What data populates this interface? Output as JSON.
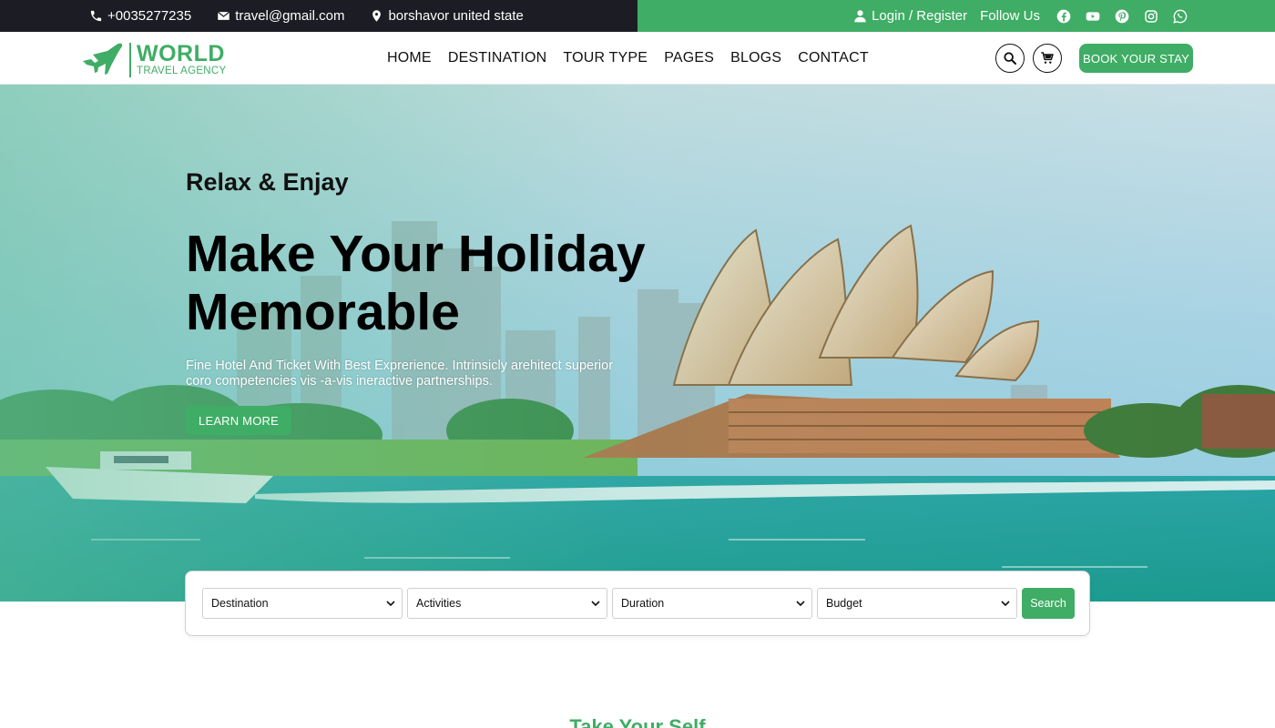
{
  "topbar": {
    "phone": "+0035277235",
    "email": "travel@gmail.com",
    "address": "borshavor united state",
    "login": "Login / Register",
    "follow": "Follow Us",
    "social_icons": [
      "facebook-icon",
      "youtube-icon",
      "pinterest-icon",
      "instagram-icon",
      "whatsapp-icon"
    ]
  },
  "logo": {
    "main": "WORLD",
    "sub": "TRAVEL AGENCY"
  },
  "nav": {
    "items": [
      "HOME",
      "DESTINATION",
      "TOUR TYPE",
      "PAGES",
      "BLOGS",
      "CONTACT"
    ]
  },
  "header": {
    "book_label": "BOOK YOUR STAY"
  },
  "hero": {
    "subtitle": "Relax & Enjay",
    "title": "Make Your Holiday Memorable",
    "description": "Fine Hotel And Ticket With Best Exprerience. Intrinsicly arehitect superior coro competencies vis -a-vis ineractive partnerships.",
    "button": "LEARN MORE"
  },
  "search": {
    "fields": [
      "Destination",
      "Activities",
      "Duration",
      "Budget"
    ],
    "button": "Search"
  },
  "next_section": {
    "title": "Take Your Self"
  },
  "colors": {
    "accent": "#3fad65",
    "dark": "#1c1c24"
  }
}
